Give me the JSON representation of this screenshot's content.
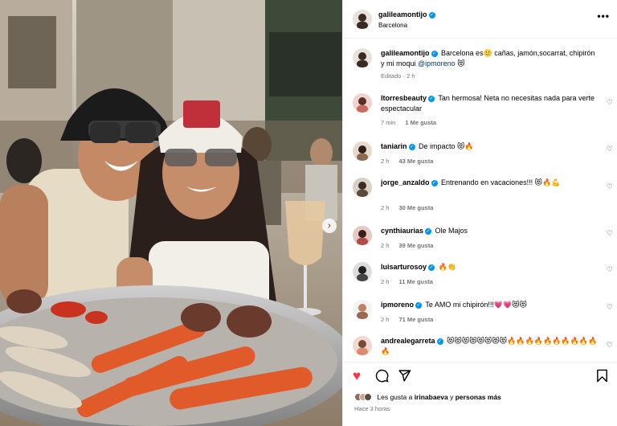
{
  "post": {
    "username": "galileamontijo",
    "location": "Barcelona",
    "more_label": "•••",
    "nav_next": "›"
  },
  "caption": {
    "username": "galileamontijo",
    "text": "Barcelona es🙂 cañas, jamón,socarrat, chipirón y mi moqui",
    "mention": "@ipmoreno",
    "emoji": "😻",
    "meta": "Editado · 2 h"
  },
  "comments": [
    {
      "username": "ltorresbeauty",
      "text": "Tan hermosa! Neta no necesitas nada para verte espectacular",
      "time": "7 min",
      "likes": "1 Me gusta",
      "verified": true
    },
    {
      "username": "taniarin",
      "text": "De impacto 😻🔥",
      "time": "2 h",
      "likes": "43 Me gusta",
      "verified": true
    },
    {
      "username": "jorge_anzaldo",
      "text": "Entrenando en vacaciones!!! 😻🔥💪",
      "time": "2 h",
      "likes": "30 Me gusta",
      "verified": true
    },
    {
      "username": "cynthiaurias",
      "text": "Ole Majos",
      "time": "2 h",
      "likes": "39 Me gusta",
      "verified": true
    },
    {
      "username": "luisarturosoy",
      "text": "🔥👏",
      "time": "2 h",
      "likes": "11 Me gusta",
      "verified": true
    },
    {
      "username": "ipmoreno",
      "text": "Te AMO mi chipirón!!!💗💗😻😻",
      "time": "2 h",
      "likes": "71 Me gusta",
      "verified": true
    },
    {
      "username": "andrealegarreta",
      "text": "😻😻😻😻😻😻😻😻🔥🔥🔥🔥🔥🔥🔥🔥🔥🔥🔥",
      "time": "",
      "likes": "",
      "verified": true
    }
  ],
  "actions": {
    "like_icon": "heart-filled",
    "comment_icon": "comment-bubble",
    "share_icon": "paper-plane",
    "save_icon": "bookmark"
  },
  "likes_text": {
    "prefix": "Les gusta a ",
    "user": "irinabaeva",
    "middle": " y ",
    "rest": "personas más"
  },
  "time_ago": "Hace 3 horas",
  "colors": {
    "accent_blue": "#0095f6",
    "like_red": "#ff3040",
    "muted": "#737373",
    "mention": "#00376b"
  }
}
